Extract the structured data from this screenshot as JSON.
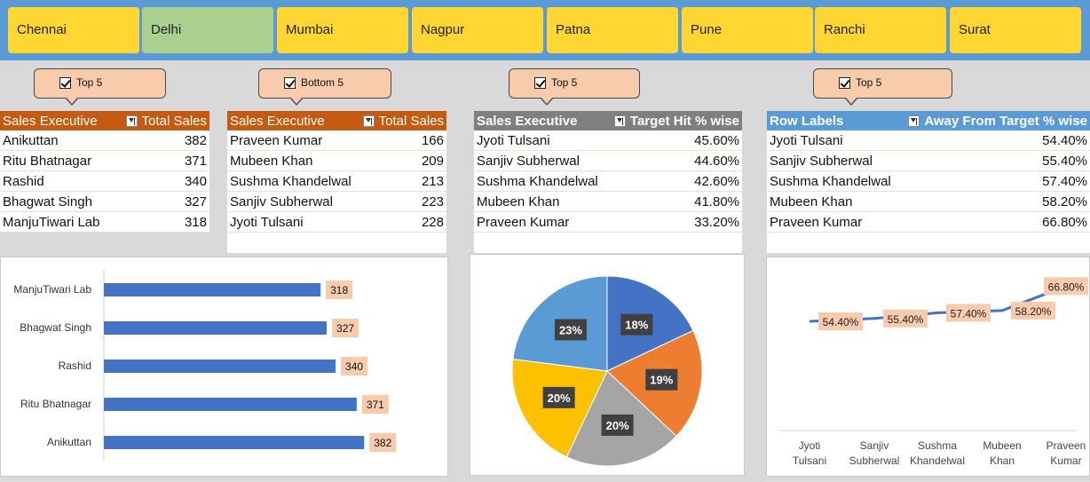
{
  "slicer": {
    "items": [
      "Chennai",
      "Delhi",
      "Mumbai",
      "Nagpur",
      "Patna",
      "Pune",
      "Ranchi",
      "Surat"
    ],
    "selected": "Delhi"
  },
  "callouts": {
    "c1": "Top 5",
    "c2": "Bottom 5",
    "c3": "Top 5",
    "c4": "Top 5"
  },
  "table1": {
    "col1": "Sales Executive",
    "col2": "Total Sales",
    "rows": [
      {
        "name": "Anikuttan",
        "value": "382"
      },
      {
        "name": "Ritu Bhatnagar",
        "value": "371"
      },
      {
        "name": "Rashid",
        "value": "340"
      },
      {
        "name": "Bhagwat Singh",
        "value": "327"
      },
      {
        "name": "ManjuTiwari Lab",
        "value": "318"
      }
    ]
  },
  "table2": {
    "col1": "Sales Executive",
    "col2": "Total Sales",
    "rows": [
      {
        "name": "Praveen Kumar",
        "value": "166"
      },
      {
        "name": "Mubeen Khan",
        "value": "209"
      },
      {
        "name": "Sushma Khandelwal",
        "value": "213"
      },
      {
        "name": "Sanjiv Subherwal",
        "value": "223"
      },
      {
        "name": "Jyoti Tulsani",
        "value": "228"
      }
    ]
  },
  "table3": {
    "col1": "Sales Executive",
    "col2": "Target Hit % wise",
    "rows": [
      {
        "name": "Jyoti Tulsani",
        "value": "45.60%"
      },
      {
        "name": "Sanjiv Subherwal",
        "value": "44.60%"
      },
      {
        "name": "Sushma Khandelwal",
        "value": "42.60%"
      },
      {
        "name": "Mubeen Khan",
        "value": "41.80%"
      },
      {
        "name": "Praveen Kumar",
        "value": "33.20%"
      }
    ]
  },
  "table4": {
    "col1": "Row Labels",
    "col2": "Away From Target % wise",
    "rows": [
      {
        "name": "Jyoti Tulsani",
        "value": "54.40%"
      },
      {
        "name": "Sanjiv Subherwal",
        "value": "55.40%"
      },
      {
        "name": "Sushma Khandelwal",
        "value": "57.40%"
      },
      {
        "name": "Mubeen Khan",
        "value": "58.20%"
      },
      {
        "name": "Praveen Kumar",
        "value": "66.80%"
      }
    ]
  },
  "colors": {
    "bar": "#4472c4",
    "label_bg": "#f8cbad",
    "pie": [
      "#4472c4",
      "#ed7d31",
      "#a5a5a5",
      "#ffc000",
      "#5b9bd5"
    ]
  },
  "chart_data": [
    {
      "type": "bar",
      "orientation": "horizontal",
      "categories": [
        "ManjuTiwari Lab",
        "Bhagwat Singh",
        "Rashid",
        "Ritu Bhatnagar",
        "Anikuttan"
      ],
      "values": [
        318,
        327,
        340,
        371,
        382
      ],
      "xlim": [
        0,
        400
      ]
    },
    {
      "type": "pie",
      "values": [
        18,
        19,
        20,
        20,
        23
      ],
      "labels": [
        "18%",
        "19%",
        "20%",
        "20%",
        "23%"
      ]
    },
    {
      "type": "line",
      "categories": [
        [
          "Jyoti",
          "Tulsani"
        ],
        [
          "Sanjiv",
          "Subherwal"
        ],
        [
          "Sushma",
          "Khandelwal"
        ],
        [
          "Mubeen",
          "Khan"
        ],
        [
          "Praveen",
          "Kumar"
        ]
      ],
      "values": [
        54.4,
        55.4,
        57.4,
        58.2,
        66.8
      ],
      "labels": [
        "54.40%",
        "55.40%",
        "57.40%",
        "58.20%",
        "66.80%"
      ],
      "ylim": [
        0,
        100
      ]
    }
  ]
}
